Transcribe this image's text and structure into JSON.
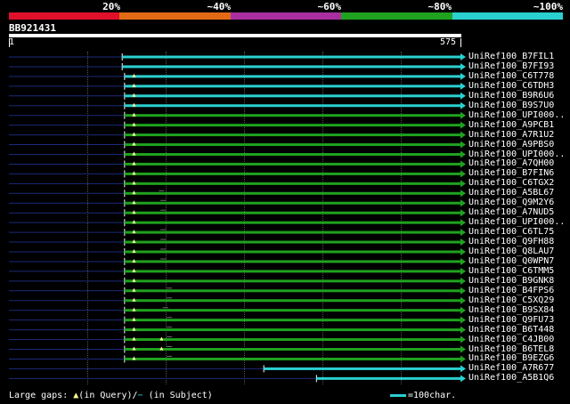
{
  "identity_scale": {
    "labels": [
      "20%",
      "~40%",
      "~60%",
      "~80%",
      "~100%"
    ],
    "colors": [
      "#e0102a",
      "#e36a15",
      "#a92fa0",
      "#1fa21f",
      "#2ad0d0"
    ]
  },
  "query": {
    "name": "BB921431",
    "start": "1",
    "end": "575",
    "length": 575
  },
  "hits": [
    {
      "name": "UniRef100_B7FIL1",
      "start": 145,
      "color": "#2ad0d0"
    },
    {
      "name": "UniRef100_B7FI93",
      "start": 145,
      "color": "#2ad0d0"
    },
    {
      "name": "UniRef100_C6T778",
      "start": 148,
      "color": "#2ad0d0",
      "gaps": [
        160
      ]
    },
    {
      "name": "UniRef100_C6TDH3",
      "start": 148,
      "color": "#2ad0d0",
      "gaps": [
        160
      ]
    },
    {
      "name": "UniRef100_B9R6U6",
      "start": 148,
      "color": "#2ad0d0",
      "gaps": [
        160
      ]
    },
    {
      "name": "UniRef100_B9S7U0",
      "start": 148,
      "color": "#2ad0d0",
      "gaps": [
        160
      ]
    },
    {
      "name": "UniRef100_UPI000..",
      "start": 148,
      "color": "#1fa21f",
      "gaps": [
        160
      ]
    },
    {
      "name": "UniRef100_A9PCB1",
      "start": 148,
      "color": "#1fa21f",
      "gaps": [
        160
      ]
    },
    {
      "name": "UniRef100_A7R1U2",
      "start": 148,
      "color": "#1fa21f",
      "gaps": [
        160
      ]
    },
    {
      "name": "UniRef100_A9PBS0",
      "start": 148,
      "color": "#1fa21f",
      "gaps": [
        160
      ]
    },
    {
      "name": "UniRef100_UPI000..",
      "start": 148,
      "color": "#1fa21f",
      "gaps": [
        160
      ]
    },
    {
      "name": "UniRef100_A7QH00",
      "start": 148,
      "color": "#1fa21f",
      "gaps": [
        160
      ]
    },
    {
      "name": "UniRef100_B7FIN6",
      "start": 148,
      "color": "#1fa21f",
      "gaps": [
        160
      ]
    },
    {
      "name": "UniRef100_C6TGX2",
      "start": 148,
      "color": "#1fa21f",
      "gaps": [
        160
      ]
    },
    {
      "name": "UniRef100_A5BL67",
      "start": 148,
      "color": "#1fa21f",
      "gaps": [
        160
      ],
      "mark": 195
    },
    {
      "name": "UniRef100_Q9M2Y6",
      "start": 148,
      "color": "#1fa21f",
      "gaps": [
        160
      ],
      "mark": 197
    },
    {
      "name": "UniRef100_A7NUD5",
      "start": 148,
      "color": "#1fa21f",
      "gaps": [
        160
      ],
      "mark": 197
    },
    {
      "name": "UniRef100_UPI000..",
      "start": 148,
      "color": "#1fa21f",
      "gaps": [
        160
      ]
    },
    {
      "name": "UniRef100_C6TL75",
      "start": 148,
      "color": "#1fa21f",
      "gaps": [
        160
      ],
      "mark": 197
    },
    {
      "name": "UniRef100_Q9FH88",
      "start": 148,
      "color": "#1fa21f",
      "gaps": [
        160
      ],
      "mark": 197
    },
    {
      "name": "UniRef100_Q8LAU7",
      "start": 148,
      "color": "#1fa21f",
      "gaps": [
        160
      ],
      "mark": 197
    },
    {
      "name": "UniRef100_Q0WPN7",
      "start": 148,
      "color": "#1fa21f",
      "gaps": [
        160
      ],
      "mark": 197
    },
    {
      "name": "UniRef100_C6TMM5",
      "start": 148,
      "color": "#1fa21f",
      "gaps": [
        160
      ]
    },
    {
      "name": "UniRef100_B9GNK8",
      "start": 148,
      "color": "#1fa21f",
      "gaps": [
        160
      ]
    },
    {
      "name": "UniRef100_B4FPS6",
      "start": 148,
      "color": "#1fa21f",
      "gaps": [
        160
      ],
      "mark": 205
    },
    {
      "name": "UniRef100_C5XQ29",
      "start": 148,
      "color": "#1fa21f",
      "gaps": [
        160
      ],
      "mark": 205
    },
    {
      "name": "UniRef100_B9SX84",
      "start": 148,
      "color": "#1fa21f",
      "gaps": [
        160
      ],
      "mark": 200
    },
    {
      "name": "UniRef100_Q9FU73",
      "start": 148,
      "color": "#1fa21f",
      "gaps": [
        160
      ],
      "mark": 205
    },
    {
      "name": "UniRef100_B6T448",
      "start": 148,
      "color": "#1fa21f",
      "gaps": [
        160
      ],
      "mark": 205
    },
    {
      "name": "UniRef100_C4JB00",
      "start": 148,
      "color": "#1fa21f",
      "gaps": [
        160,
        195
      ],
      "mark": 205
    },
    {
      "name": "UniRef100_B6TEL8",
      "start": 148,
      "color": "#1fa21f",
      "gaps": [
        160,
        195
      ],
      "mark": 205
    },
    {
      "name": "UniRef100_B9EZG6",
      "start": 148,
      "color": "#1fa21f",
      "gaps": [
        160
      ],
      "mark": 205
    },
    {
      "name": "UniRef100_A7R677",
      "start": 325,
      "color": "#2ad0d0"
    },
    {
      "name": "UniRef100_A5B1Q6",
      "start": 392,
      "color": "#2ad0d0"
    }
  ],
  "legend": {
    "gaps_prefix": "Large gaps:",
    "triangle_symbol": "▲",
    "in_query": "(in Query)/",
    "dash_symbol": "−",
    "in_subject": " (in Subject)",
    "scale_text": "=100char."
  }
}
